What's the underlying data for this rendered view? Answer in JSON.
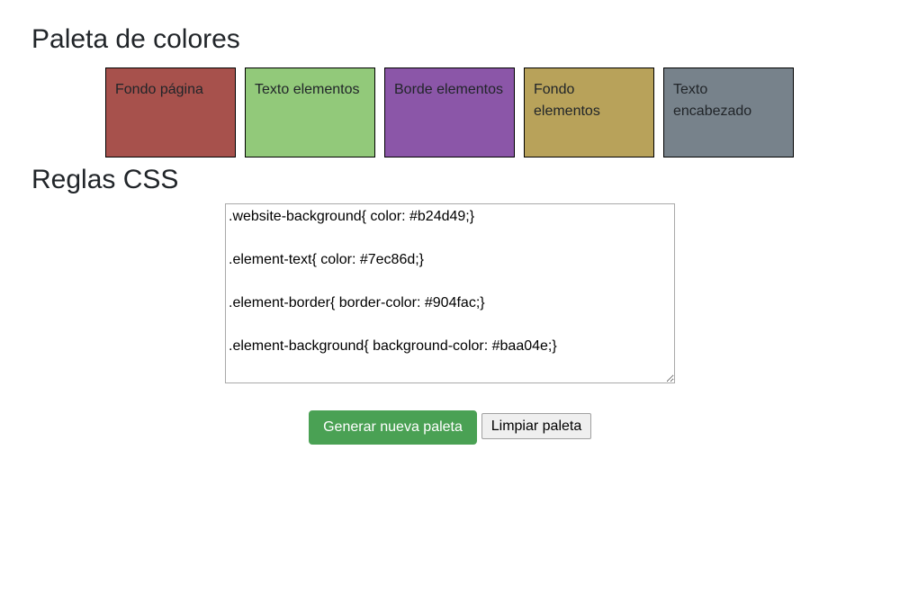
{
  "palette": {
    "title": "Paleta de colores",
    "swatches": [
      {
        "label": "Fondo página",
        "color": "#a7514c"
      },
      {
        "label": "Texto elementos",
        "color": "#92c97a"
      },
      {
        "label": "Borde elementos",
        "color": "#8b56a8"
      },
      {
        "label": "Fondo elementos",
        "color": "#b8a25a"
      },
      {
        "label": "Texto encabezado",
        "color": "#77828b"
      }
    ]
  },
  "css_rules": {
    "title": "Reglas CSS",
    "text": ".website-background{ color: #b24d49;}\n\n.element-text{ color: #7ec86d;}\n\n.element-border{ border-color: #904fac;}\n\n.element-background{ background-color: #baa04e;}"
  },
  "actions": {
    "generate_label": "Generar nueva paleta",
    "clear_label": "Limpiar paleta"
  },
  "colors": {
    "generate_button": "#4aa154"
  }
}
